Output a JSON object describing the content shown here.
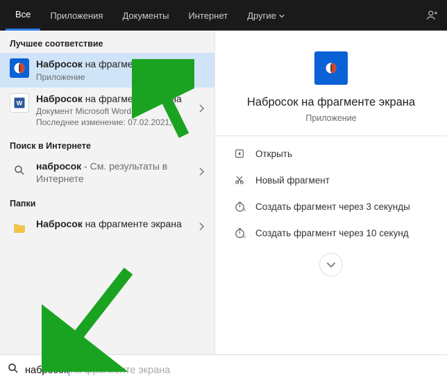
{
  "tabs": {
    "all": "Все",
    "apps": "Приложения",
    "docs": "Документы",
    "internet": "Интернет",
    "other": "Другие"
  },
  "sections": {
    "best": "Лучшее соответствие",
    "web": "Поиск в Интернете",
    "folders": "Папки"
  },
  "results": {
    "app": {
      "bold": "Набросок",
      "rest": " на фрагменте экрана",
      "sub": "Приложение"
    },
    "doc": {
      "bold": "Набросок",
      "rest": " на фрагменте экрана",
      "sub1": "Документ Microsoft Word",
      "sub2": "Последнее изменение: 07.02.2021, 1..."
    },
    "web": {
      "bold": "набросок",
      "rest": " - См. результаты в Интернете"
    },
    "folder": {
      "bold": "Набросок",
      "rest": " на фрагменте экрана"
    }
  },
  "preview": {
    "title": "Набросок на фрагменте экрана",
    "sub": "Приложение"
  },
  "actions": {
    "open": "Открыть",
    "new": "Новый фрагмент",
    "delay3": "Создать фрагмент через 3 секунды",
    "delay10": "Создать фрагмент через 10 секунд"
  },
  "search": {
    "typed": "набросок",
    "hint": "на фрагменте экрана"
  }
}
